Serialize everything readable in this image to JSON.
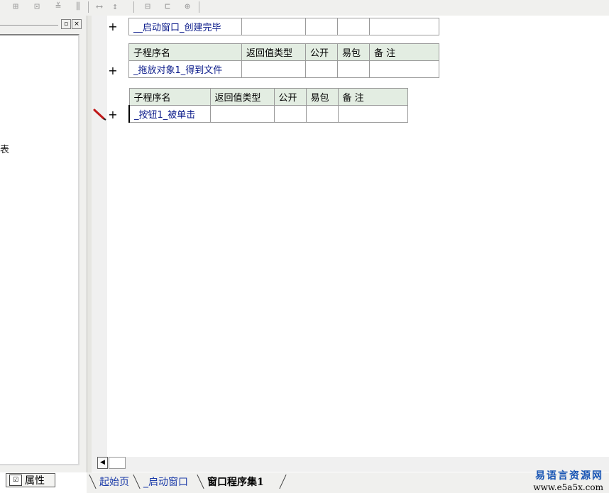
{
  "toolbar": {
    "icons": [
      "align-left-icon",
      "align-center-icon",
      "align-top-icon",
      "align-distribute-icon",
      "equal-spacing-h-icon",
      "equal-spacing-v-icon",
      "same-width-icon",
      "same-height-icon",
      "same-size-icon"
    ]
  },
  "left_panel": {
    "truncated_text": "表",
    "restore_glyph": "▫",
    "close_glyph": "×",
    "properties_tab": "属性"
  },
  "code": {
    "header": {
      "name": "子程序名",
      "return_type": "返回值类型",
      "public": "公开",
      "easy_pack": "易包",
      "remark": "备 注"
    },
    "subs": [
      {
        "name": "__启动窗口_创建完毕",
        "return_type": "",
        "public": "",
        "easy_pack": "",
        "remark": ""
      },
      {
        "name": "_拖放对象1_得到文件",
        "return_type": "",
        "public": "",
        "easy_pack": "",
        "remark": ""
      },
      {
        "name": "_按钮1_被单击",
        "return_type": "",
        "public": "",
        "easy_pack": "",
        "remark": ""
      }
    ],
    "expand_glyph": "+"
  },
  "scrollbar": {
    "left_arrow": "◀"
  },
  "tabs": [
    {
      "label": "起始页",
      "active": false,
      "color": "#1a3aa8"
    },
    {
      "label": "_启动窗口",
      "active": false,
      "color": "#1a3aa8"
    },
    {
      "label": "窗口程序集1",
      "active": true,
      "color": "#000000"
    }
  ],
  "watermark": {
    "chinese": "易语言资源网",
    "url": "www.e5a5x.com"
  },
  "colors": {
    "header_bg": "#e3ede2",
    "sub_name": "#0a1a8a",
    "pencil": "#c01818"
  }
}
